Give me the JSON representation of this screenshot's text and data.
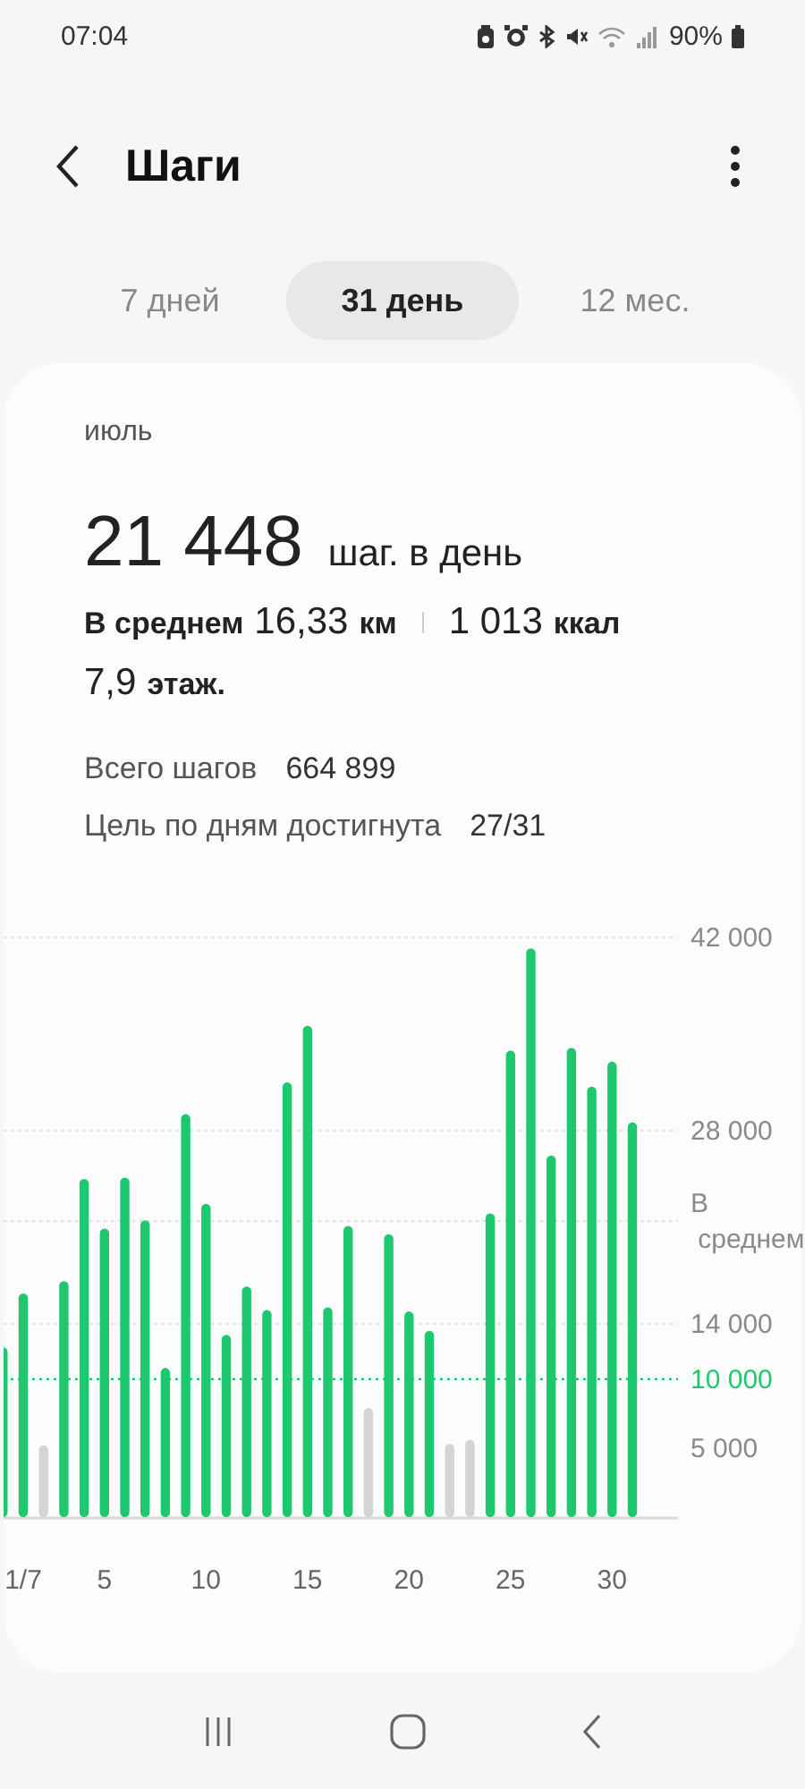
{
  "status_bar": {
    "time": "07:04",
    "battery": "90%"
  },
  "header": {
    "title": "Шаги"
  },
  "tabs": [
    {
      "label": "7 дней",
      "selected": false
    },
    {
      "label": "31 день",
      "selected": true
    },
    {
      "label": "12 мес.",
      "selected": false
    }
  ],
  "card": {
    "period": "июль",
    "daily_steps": "21 448",
    "daily_steps_unit": "шаг. в день",
    "average_label": "В среднем",
    "distance": "16,33",
    "distance_unit": "км",
    "calories": "1 013",
    "calories_unit": "ккал",
    "floors": "7,9",
    "floors_unit": "этаж.",
    "total_label": "Всего шагов",
    "total_value": "664 899",
    "goal_label": "Цель по дням достигнута",
    "goal_value": "27/31",
    "chart_data": {
      "type": "bar",
      "x": [
        0,
        1,
        2,
        3,
        4,
        5,
        6,
        7,
        8,
        9,
        10,
        11,
        12,
        13,
        14,
        15,
        16,
        17,
        18,
        19,
        20,
        21,
        22,
        23,
        24,
        25,
        26,
        27,
        28,
        29,
        30,
        31
      ],
      "series": [
        {
          "color": "#1ec86e",
          "values": [
            12300,
            16200,
            null,
            17100,
            24500,
            20900,
            24600,
            21500,
            10800,
            29200,
            22700,
            13200,
            16700,
            15000,
            31500,
            35600,
            15200,
            21100,
            null,
            20500,
            14900,
            13500,
            null,
            null,
            22000,
            33800,
            41200,
            26200,
            34000,
            31200,
            33000,
            28600
          ]
        },
        {
          "color": "#d4d4d4",
          "values": [
            null,
            null,
            5200,
            null,
            null,
            null,
            null,
            null,
            null,
            null,
            null,
            null,
            null,
            null,
            null,
            null,
            null,
            null,
            7900,
            null,
            null,
            null,
            5300,
            5600,
            null,
            null,
            null,
            null,
            null,
            null,
            null,
            null
          ]
        }
      ],
      "grid": true,
      "xlim": [
        0,
        31
      ],
      "ylim": [
        0,
        42000
      ],
      "xticks": [
        {
          "value": 1,
          "label": "1/7"
        },
        {
          "value": 5,
          "label": "5"
        },
        {
          "value": 10,
          "label": "10"
        },
        {
          "value": 15,
          "label": "15"
        },
        {
          "value": 20,
          "label": "20"
        },
        {
          "value": 25,
          "label": "25"
        },
        {
          "value": 30,
          "label": "30"
        }
      ],
      "yticks": [
        {
          "value": 5000,
          "label": "5 000"
        },
        {
          "value": 10000,
          "label": "10 000"
        },
        {
          "value": 14000,
          "label": "14 000"
        },
        {
          "value": 21448,
          "label": "В среднем"
        },
        {
          "value": 28000,
          "label": "28 000"
        },
        {
          "value": 42000,
          "label": "42 000"
        }
      ],
      "ref_lines": [
        {
          "axis": "y",
          "value": 10000,
          "color": "#1ec86e"
        }
      ]
    }
  }
}
